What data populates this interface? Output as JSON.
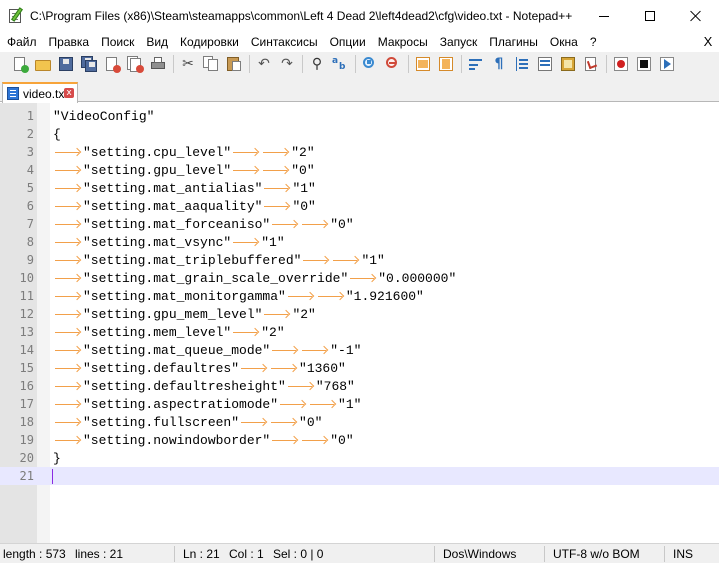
{
  "window": {
    "title": "C:\\Program Files (x86)\\Steam\\steamapps\\common\\Left 4 Dead 2\\left4dead2\\cfg\\video.txt - Notepad++"
  },
  "menu": [
    "Файл",
    "Правка",
    "Поиск",
    "Вид",
    "Кодировки",
    "Синтаксисы",
    "Опции",
    "Макросы",
    "Запуск",
    "Плагины",
    "Окна",
    "?"
  ],
  "menu_close": "X",
  "toolbar_icons": [
    "new-file-icon",
    "open-file-icon",
    "save-icon",
    "save-all-icon",
    "close-file-icon",
    "close-all-icon",
    "print-icon",
    "cut-icon",
    "copy-icon",
    "paste-icon",
    "undo-icon",
    "redo-icon",
    "find-icon",
    "replace-icon",
    "zoom-in-icon",
    "zoom-out-icon",
    "sync-vertical-icon",
    "sync-horizontal-icon",
    "word-wrap-icon",
    "show-all-characters-icon",
    "indent-guide-icon",
    "udl-icon",
    "document-map-icon",
    "function-list-icon",
    "record-macro-icon",
    "stop-recording-icon",
    "play-macro-icon"
  ],
  "tab": {
    "label": "video.txt",
    "close": "x"
  },
  "editor": {
    "lines": [
      {
        "num": "1",
        "indent": [],
        "text": "\"VideoConfig\""
      },
      {
        "num": "2",
        "indent": [],
        "text": "{"
      },
      {
        "num": "3",
        "key": "\"setting.cpu_level\"",
        "tabs": 2,
        "value": "\"2\""
      },
      {
        "num": "4",
        "key": "\"setting.gpu_level\"",
        "tabs": 2,
        "value": "\"0\""
      },
      {
        "num": "5",
        "key": "\"setting.mat_antialias\"",
        "tabs": 1,
        "value": "\"1\""
      },
      {
        "num": "6",
        "key": "\"setting.mat_aaquality\"",
        "tabs": 1,
        "value": "\"0\""
      },
      {
        "num": "7",
        "key": "\"setting.mat_forceaniso\"",
        "tabs": 2,
        "value": "\"0\""
      },
      {
        "num": "8",
        "key": "\"setting.mat_vsync\"",
        "tabs": 1,
        "value": "\"1\""
      },
      {
        "num": "9",
        "key": "\"setting.mat_triplebuffered\"",
        "tabs": 2,
        "value": "\"1\""
      },
      {
        "num": "10",
        "key": "\"setting.mat_grain_scale_override\"",
        "tabs": 1,
        "value": "\"0.000000\""
      },
      {
        "num": "11",
        "key": "\"setting.mat_monitorgamma\"",
        "tabs": 2,
        "value": "\"1.921600\""
      },
      {
        "num": "12",
        "key": "\"setting.gpu_mem_level\"",
        "tabs": 1,
        "value": "\"2\""
      },
      {
        "num": "13",
        "key": "\"setting.mem_level\"",
        "tabs": 1,
        "value": "\"2\""
      },
      {
        "num": "14",
        "key": "\"setting.mat_queue_mode\"",
        "tabs": 2,
        "value": "\"-1\""
      },
      {
        "num": "15",
        "key": "\"setting.defaultres\"",
        "tabs": 2,
        "value": "\"1360\""
      },
      {
        "num": "16",
        "key": "\"setting.defaultresheight\"",
        "tabs": 1,
        "value": "\"768\""
      },
      {
        "num": "17",
        "key": "\"setting.aspectratiomode\"",
        "tabs": 2,
        "value": "\"1\""
      },
      {
        "num": "18",
        "key": "\"setting.fullscreen\"",
        "tabs": 2,
        "value": "\"0\""
      },
      {
        "num": "19",
        "key": "\"setting.nowindowborder\"",
        "tabs": 2,
        "value": "\"0\""
      },
      {
        "num": "20",
        "indent": [],
        "text": "}"
      },
      {
        "num": "21",
        "indent": [],
        "text": "",
        "current": true
      }
    ]
  },
  "status": {
    "length": "length : 573",
    "lines": "lines : 21",
    "ln": "Ln : 21",
    "col": "Col : 1",
    "sel": "Sel : 0 | 0",
    "eol": "Dos\\Windows",
    "encoding": "UTF-8 w/o BOM",
    "mode": "INS"
  },
  "colors": {
    "tab_accent": "#f7a43a",
    "tab_arrow": "#f2a04a",
    "line_numbers": "#7c7c7c",
    "current_line": "#e8e8ff"
  }
}
